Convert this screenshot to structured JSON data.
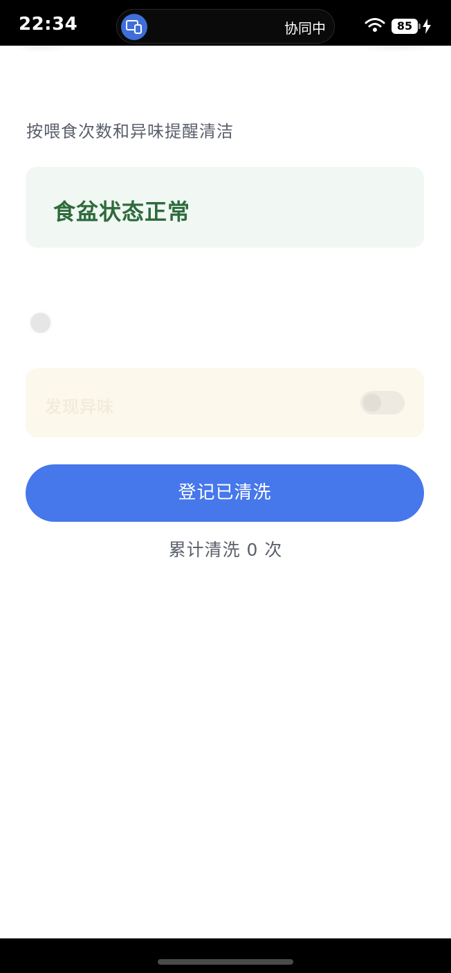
{
  "status_bar": {
    "time": "22:34",
    "island_text": "协同中",
    "island_icon": "multi-device-icon",
    "battery": "85",
    "wifi_icon": "wifi-icon",
    "charging_icon": "bolt-icon"
  },
  "page": {
    "hint": "按喂食次数和异味提醒清洁",
    "status_title": "食盆状态正常",
    "odor_label": "发现异味",
    "odor_toggle_on": false,
    "clean_button_label": "登记已清洗",
    "count_text": "累计清洗 0 次"
  },
  "colors": {
    "accent": "#4677eb",
    "status_ok_text": "#2e6b3c",
    "status_ok_bg": "#f1f8f3",
    "odor_bg": "#fdf8ec"
  }
}
